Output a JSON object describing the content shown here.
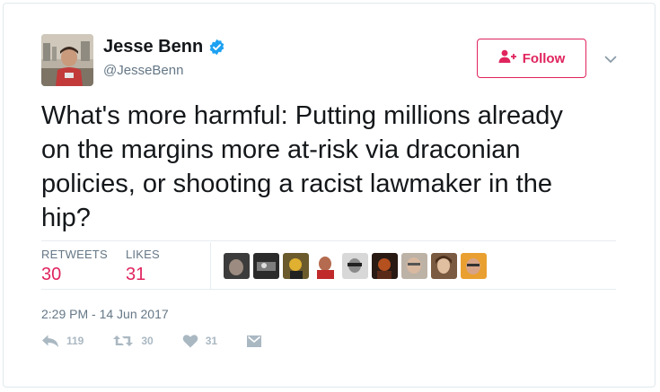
{
  "user": {
    "name": "Jesse Benn",
    "handle": "@JesseBenn",
    "verified_icon": "verified-badge-icon"
  },
  "follow_button": {
    "label": "Follow",
    "icon": "add-person-icon"
  },
  "tweet": {
    "lines": [
      "What's more harmful: Putting millions already",
      "on the margins more at-risk via draconian",
      "policies, or shooting a racist lawmaker in the",
      "hip?"
    ]
  },
  "stats": {
    "retweets_label": "RETWEETS",
    "retweets_value": "30",
    "likes_label": "LIKES",
    "likes_value": "31"
  },
  "timestamp": "2:29 PM - 14 Jun 2017",
  "actions": {
    "reply_count": "119",
    "retweet_count": "30",
    "like_count": "31"
  },
  "colors": {
    "accent": "#e0245e",
    "verified": "#1da1f2",
    "muted": "#657786",
    "icon": "#aab8c2"
  }
}
